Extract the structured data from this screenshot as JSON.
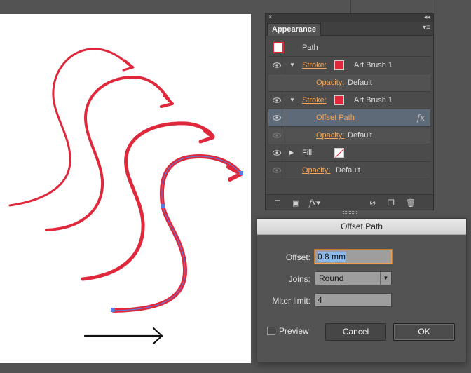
{
  "appearance_panel": {
    "tab_label": "Appearance",
    "close_glyph": "×",
    "collapse_glyph": "◂◂",
    "menu_glyph": "▾≡",
    "rows": [
      {
        "kind": "header",
        "label": "Path"
      },
      {
        "kind": "stroke",
        "label": "Stroke:",
        "value": "Art Brush 1"
      },
      {
        "kind": "opacity",
        "label": "Opacity:",
        "value": "Default"
      },
      {
        "kind": "stroke",
        "label": "Stroke:",
        "value": "Art Brush 1"
      },
      {
        "kind": "effect",
        "label": "Offset Path",
        "fx": "fx",
        "selected": true
      },
      {
        "kind": "opacity",
        "label": "Opacity:",
        "value": "Default"
      },
      {
        "kind": "fill",
        "label": "Fill:"
      },
      {
        "kind": "opacity",
        "label": "Opacity:",
        "value": "Default"
      }
    ],
    "footer": {
      "fx_label": "fx"
    }
  },
  "offset_dialog": {
    "title": "Offset Path",
    "offset_label": "Offset:",
    "offset_value": "0.8 mm",
    "joins_label": "Joins:",
    "joins_value": "Round",
    "miter_label": "Miter limit:",
    "miter_value": "4",
    "preview_label": "Preview",
    "cancel_label": "Cancel",
    "ok_label": "OK"
  },
  "colors": {
    "brush_red": "#e0283c",
    "selection_blue": "#5b7be0",
    "accent_orange": "#f2a65a"
  }
}
